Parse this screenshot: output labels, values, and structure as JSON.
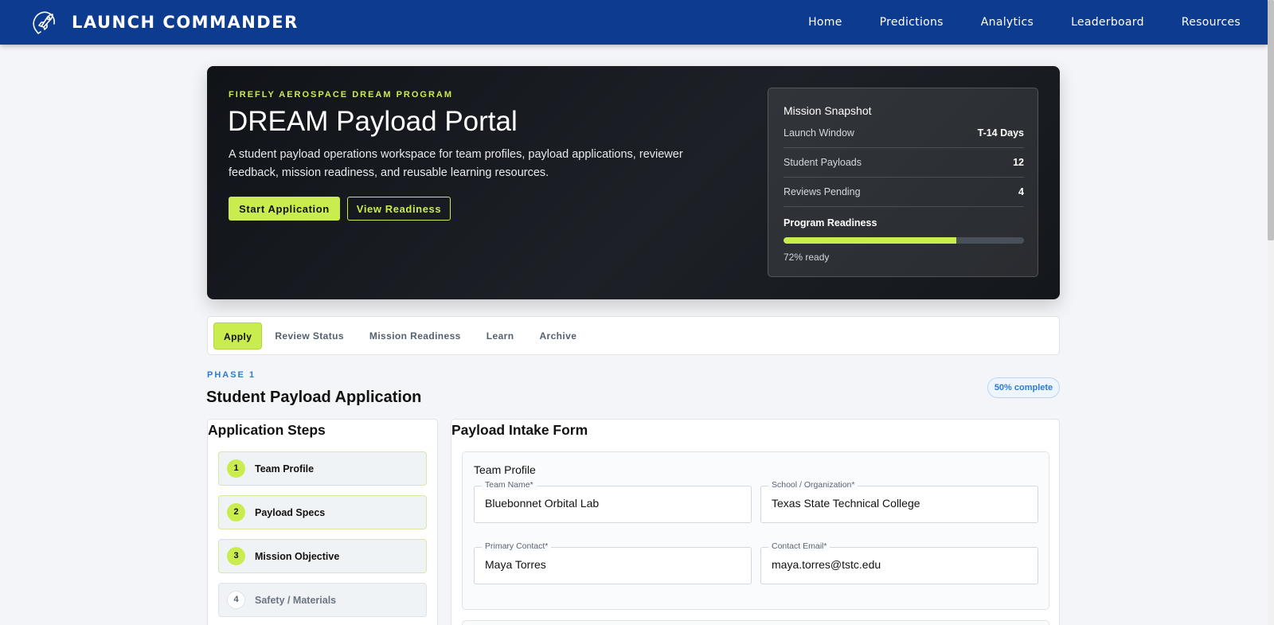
{
  "nav": {
    "brand": "LAUNCH COMMANDER",
    "links": [
      "Home",
      "Predictions",
      "Analytics",
      "Leaderboard",
      "Resources"
    ]
  },
  "hero": {
    "eyebrow": "FIREFLY AEROSPACE DREAM PROGRAM",
    "title": "DREAM Payload Portal",
    "description": "A student payload operations workspace for team profiles, payload applications, reviewer feedback, mission readiness, and reusable learning resources.",
    "primary_button": "Start Application",
    "secondary_button": "View Readiness"
  },
  "snapshot": {
    "title": "Mission Snapshot",
    "rows": [
      {
        "label": "Launch Window",
        "value": "T-14 Days"
      },
      {
        "label": "Student Payloads",
        "value": "12"
      },
      {
        "label": "Reviews Pending",
        "value": "4"
      }
    ],
    "readiness_label": "Program Readiness",
    "readiness_percent": 72,
    "readiness_text": "72% ready"
  },
  "tabs": [
    {
      "label": "Apply",
      "active": true
    },
    {
      "label": "Review Status",
      "active": false
    },
    {
      "label": "Mission Readiness",
      "active": false
    },
    {
      "label": "Learn",
      "active": false
    },
    {
      "label": "Archive",
      "active": false
    }
  ],
  "section": {
    "phase": "PHASE 1",
    "title": "Student Payload Application",
    "badge": "50% complete"
  },
  "steps_panel": {
    "title": "Application Steps",
    "steps": [
      {
        "num": "1",
        "label": "Team Profile",
        "done": true
      },
      {
        "num": "2",
        "label": "Payload Specs",
        "done": true
      },
      {
        "num": "3",
        "label": "Mission Objective",
        "done": true
      },
      {
        "num": "4",
        "label": "Safety / Materials",
        "done": false
      }
    ]
  },
  "form": {
    "title": "Payload Intake Form",
    "card_title": "Team Profile",
    "fields": [
      {
        "label": "Team Name*",
        "value": "Bluebonnet Orbital Lab"
      },
      {
        "label": "School / Organization*",
        "value": "Texas State Technical College"
      },
      {
        "label": "Primary Contact*",
        "value": "Maya Torres"
      },
      {
        "label": "Contact Email*",
        "value": "maya.torres@tstc.edu"
      }
    ]
  },
  "colors": {
    "nav_bg": "#0d3b8f",
    "accent": "#c9ec4f",
    "link_blue": "#2d7bd6"
  }
}
